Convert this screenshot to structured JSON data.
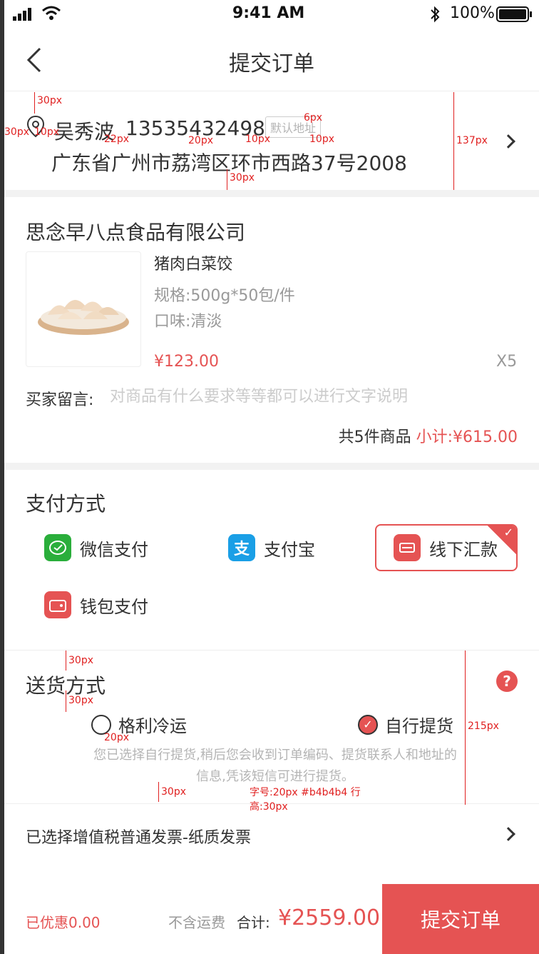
{
  "status_bar": {
    "time": "9:41 AM",
    "battery": "100%"
  },
  "nav": {
    "title": "提交订单",
    "back_icon": "back-chevron-icon"
  },
  "address": {
    "name": "吴秀波",
    "phone": "13535432498",
    "tag": "默认地址",
    "line": "广东省广州市荔湾区环市西路37号2008"
  },
  "shop": {
    "name": "思念早八点食品有限公司",
    "product": {
      "name": "猪肉白菜饺",
      "spec": "规格:500g*50包/件",
      "taste": "口味:清淡",
      "price": "¥123.00",
      "qty": "X5"
    },
    "message_label": "买家留言:",
    "message_placeholder": "对商品有什么要求等等都可以进行文字说明",
    "summary_count": "共5件商品",
    "summary_label": "小计:",
    "summary_amount": "¥615.00"
  },
  "payment": {
    "title": "支付方式",
    "options": [
      {
        "label": "微信支付",
        "icon": "wechat-icon",
        "color": "#2aae3b"
      },
      {
        "label": "支付宝",
        "icon": "alipay-icon",
        "color": "#1a9fe6"
      },
      {
        "label": "线下汇款",
        "icon": "transfer-icon",
        "color": "#e55353",
        "selected": true
      },
      {
        "label": "钱包支付",
        "icon": "wallet-icon",
        "color": "#e55353"
      }
    ]
  },
  "shipping": {
    "title": "送货方式",
    "options": [
      {
        "label": "格利冷运",
        "selected": false
      },
      {
        "label": "自行提货",
        "selected": true
      }
    ],
    "note": "您已选择自行提货,稍后您会收到订单编码、提货联系人和地址的信息,凭该短信可进行提货。"
  },
  "invoice": {
    "text": "已选择增值税普通发票-纸质发票"
  },
  "footer": {
    "discount": "已优惠0.00",
    "fee_note": "不含运费",
    "total_label": "合计:",
    "total": "¥2559.00",
    "submit": "提交订单"
  },
  "annotations": {
    "a30": "30px",
    "a10": "10px",
    "a22": "22px",
    "a20": "20px",
    "a6": "6px",
    "a137": "137px",
    "a215": "215px",
    "font_note": "字号:20px #b4b4b4 行高:30px"
  },
  "colors": {
    "accent": "#e55353",
    "note": "#b4b4b4"
  }
}
